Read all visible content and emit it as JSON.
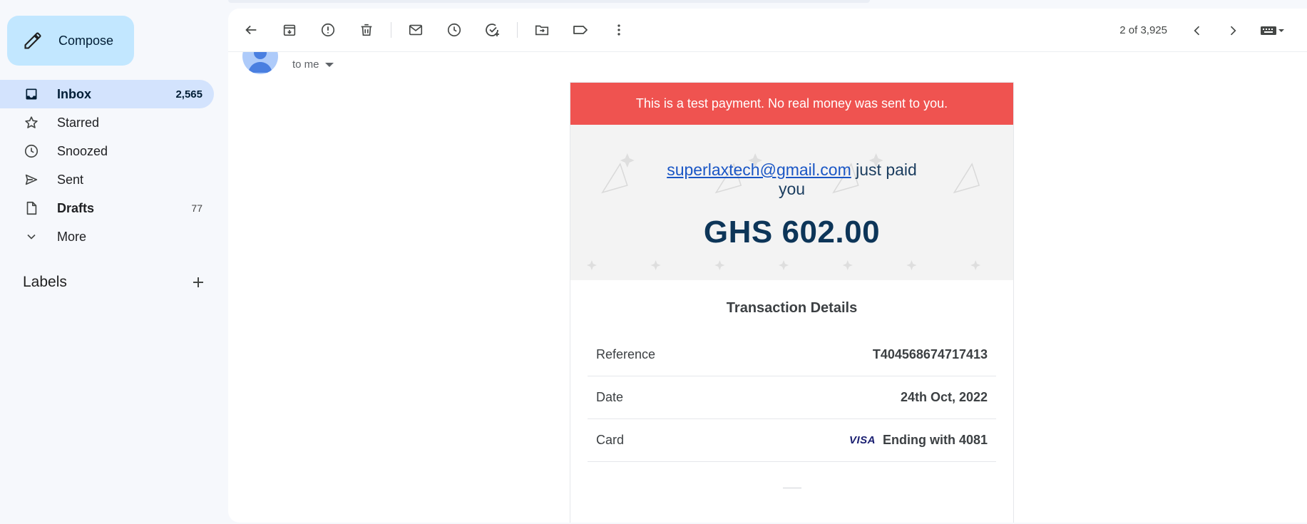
{
  "sidebar": {
    "compose_label": "Compose",
    "items": [
      {
        "label": "Inbox",
        "count": "2,565",
        "icon": "inbox-icon"
      },
      {
        "label": "Starred",
        "count": "",
        "icon": "star-icon"
      },
      {
        "label": "Snoozed",
        "count": "",
        "icon": "clock-icon"
      },
      {
        "label": "Sent",
        "count": "",
        "icon": "send-icon"
      },
      {
        "label": "Drafts",
        "count": "77",
        "icon": "draft-icon"
      },
      {
        "label": "More",
        "count": "",
        "icon": "chevron-down-icon"
      }
    ],
    "labels_heading": "Labels"
  },
  "toolbar": {
    "pager_text": "2 of 3,925"
  },
  "email": {
    "to_label": "to me",
    "banner": "This is a test payment. No real money was sent to you.",
    "payer_email": "superlaxtech@gmail.com",
    "paid_text": " just paid you",
    "amount": "GHS 602.00",
    "details_title": "Transaction Details",
    "rows": [
      {
        "key": "Reference",
        "value": "T404568674717413"
      },
      {
        "key": "Date",
        "value": "24th Oct, 2022"
      },
      {
        "key": "Card",
        "value": "Ending with 4081",
        "card_brand": "VISA"
      }
    ]
  },
  "colors": {
    "accent": "#c2e7ff",
    "active_nav": "#d3e3fd",
    "banner": "#ef5350",
    "amount": "#0d3558"
  }
}
